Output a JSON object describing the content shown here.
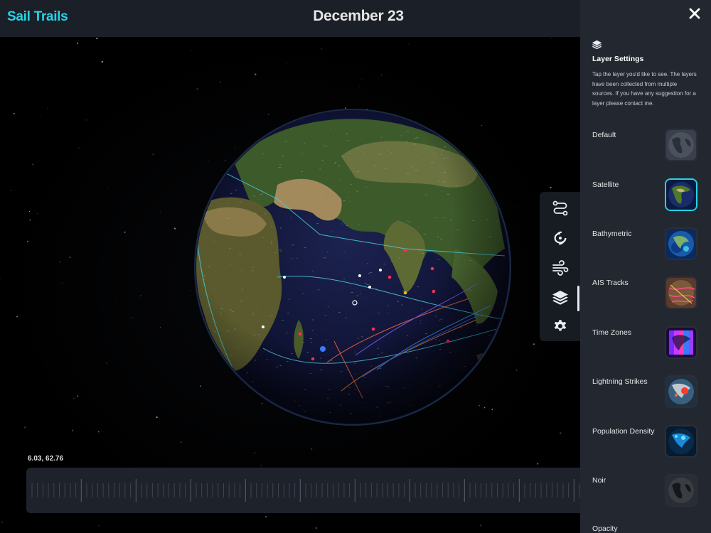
{
  "header": {
    "app_title": "Sail Trails",
    "date": "December 23"
  },
  "map": {
    "coordinates": "6.03, 62.76"
  },
  "toolbar": {
    "tools": [
      {
        "icon": "route-icon",
        "active": false
      },
      {
        "icon": "hurricane-icon",
        "active": false
      },
      {
        "icon": "wind-icon",
        "active": false
      },
      {
        "icon": "layers-icon",
        "active": true
      },
      {
        "icon": "gear-icon",
        "active": false
      }
    ]
  },
  "panel": {
    "close_icon": "close-icon",
    "header_icon": "layers-icon",
    "title": "Layer Settings",
    "description": "Tap the layer you'd like to see. The layers have been collected from multiple sources. If you have any suggestion for a layer please contact me.",
    "layers": [
      {
        "label": "Default",
        "selected": false
      },
      {
        "label": "Satellite",
        "selected": true
      },
      {
        "label": "Bathymetric",
        "selected": false
      },
      {
        "label": "AIS Tracks",
        "selected": false
      },
      {
        "label": "Time Zones",
        "selected": false
      },
      {
        "label": "Lightning Strikes",
        "selected": false
      },
      {
        "label": "Population Density",
        "selected": false
      },
      {
        "label": "Noir",
        "selected": false
      }
    ],
    "opacity_label": "Opacity"
  },
  "colors": {
    "accent": "#27d3e6",
    "panel_bg": "#232830",
    "topbar_bg": "#1b1f27"
  }
}
